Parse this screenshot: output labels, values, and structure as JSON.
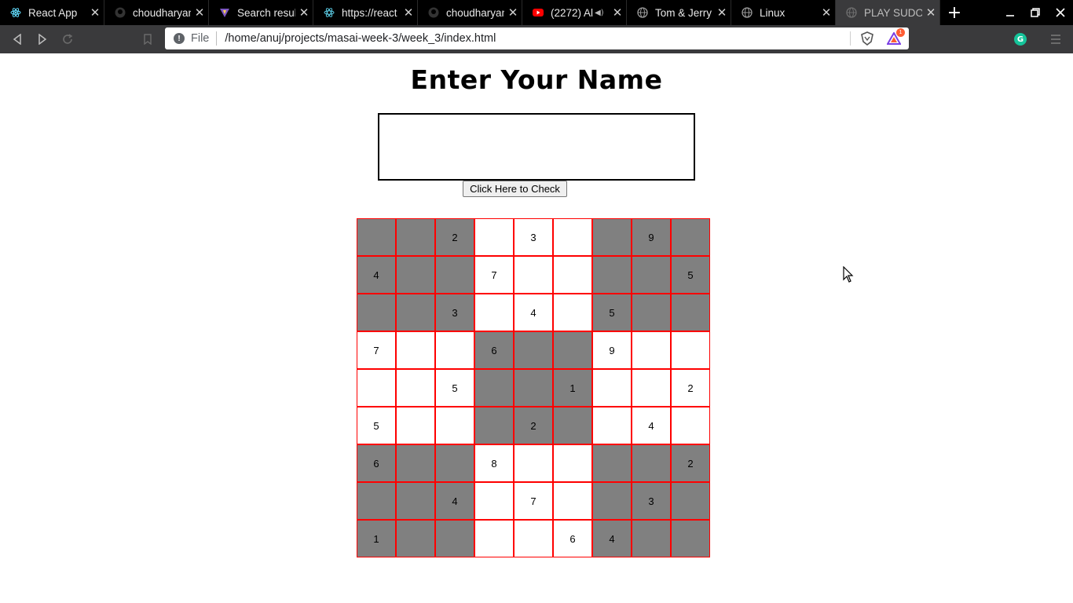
{
  "browser": {
    "tabs": [
      {
        "title": "React App",
        "icon": "react-icon",
        "active": false
      },
      {
        "title": "choudharyan",
        "icon": "github-icon",
        "active": false
      },
      {
        "title": "Search result",
        "icon": "vite-icon",
        "active": false
      },
      {
        "title": "https://react",
        "icon": "react-docs-icon",
        "active": false
      },
      {
        "title": "choudharyan",
        "icon": "github-icon",
        "active": false
      },
      {
        "title": "(2272) Al",
        "icon": "youtube-icon",
        "active": false,
        "audio": true
      },
      {
        "title": "Tom & Jerry",
        "icon": "globe-icon",
        "active": false
      },
      {
        "title": "Linux",
        "icon": "globe-icon",
        "active": false
      },
      {
        "title": "PLAY SUDOK",
        "icon": "globe-icon",
        "active": true
      }
    ],
    "address": {
      "scheme_label": "File",
      "url": "/home/anuj/projects/masai-week-3/week_3/index.html"
    },
    "rewards_badge": "1",
    "grammarly_label": "G"
  },
  "page": {
    "heading": "Enter Your Name",
    "name_input_value": "",
    "check_button_label": "Click Here to Check"
  },
  "sudoku": {
    "grid": [
      [
        "",
        "",
        "2",
        "",
        "3",
        "",
        "",
        "9",
        ""
      ],
      [
        "4",
        "",
        "",
        "7",
        "",
        "",
        "",
        "",
        "5"
      ],
      [
        "",
        "",
        "3",
        "",
        "4",
        "",
        "5",
        "",
        ""
      ],
      [
        "7",
        "",
        "",
        "6",
        "",
        "",
        "9",
        "",
        ""
      ],
      [
        "",
        "",
        "5",
        "",
        "",
        "1",
        "",
        "",
        "2"
      ],
      [
        "5",
        "",
        "",
        "",
        "2",
        "",
        "",
        "4",
        ""
      ],
      [
        "6",
        "",
        "",
        "8",
        "",
        "",
        "",
        "",
        "2"
      ],
      [
        "",
        "",
        "4",
        "",
        "7",
        "",
        "",
        "3",
        ""
      ],
      [
        "1",
        "",
        "",
        "",
        "",
        "6",
        "4",
        "",
        ""
      ]
    ],
    "colors": {
      "shaded": "#808080",
      "plain": "#ffffff",
      "border": "#ff0000"
    }
  }
}
